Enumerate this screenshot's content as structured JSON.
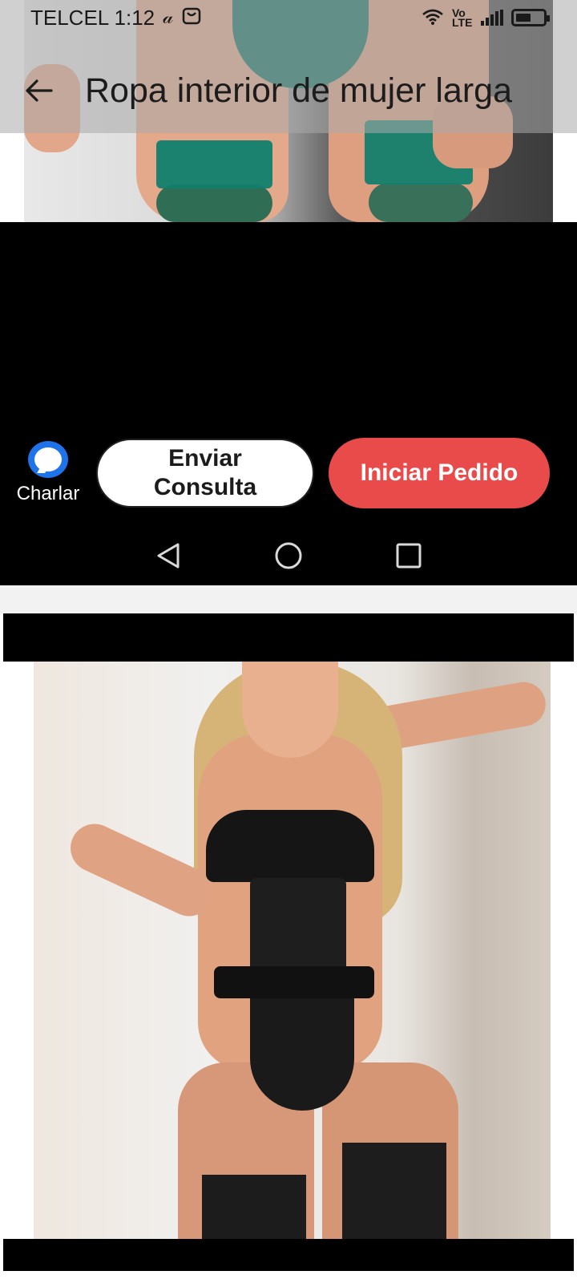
{
  "status_bar": {
    "carrier_time": "TELCEL 1:12",
    "icons": [
      "alibaba-icon",
      "shopping-bag-icon",
      "wifi-icon",
      "volte-icon",
      "signal-icon",
      "battery-icon"
    ],
    "network_label": "Vo LTE"
  },
  "header": {
    "title": "Ropa interior de mujer larga",
    "back_icon": "arrow-left-icon"
  },
  "action_bar": {
    "chat_label": "Charlar",
    "chat_icon": "chat-bubble-icon",
    "chat_color": "#1e73e8",
    "consulta_line1": "Enviar",
    "consulta_line2": "Consulta",
    "pedido_label": "Iniciar Pedido",
    "pedido_color": "#e94a4a"
  },
  "nav_bar": {
    "back_icon": "nav-back-triangle-icon",
    "home_icon": "nav-home-circle-icon",
    "recents_icon": "nav-recents-square-icon"
  },
  "images": {
    "top": "product-photo-green-lingerie",
    "bottom": "product-photo-black-lingerie"
  }
}
